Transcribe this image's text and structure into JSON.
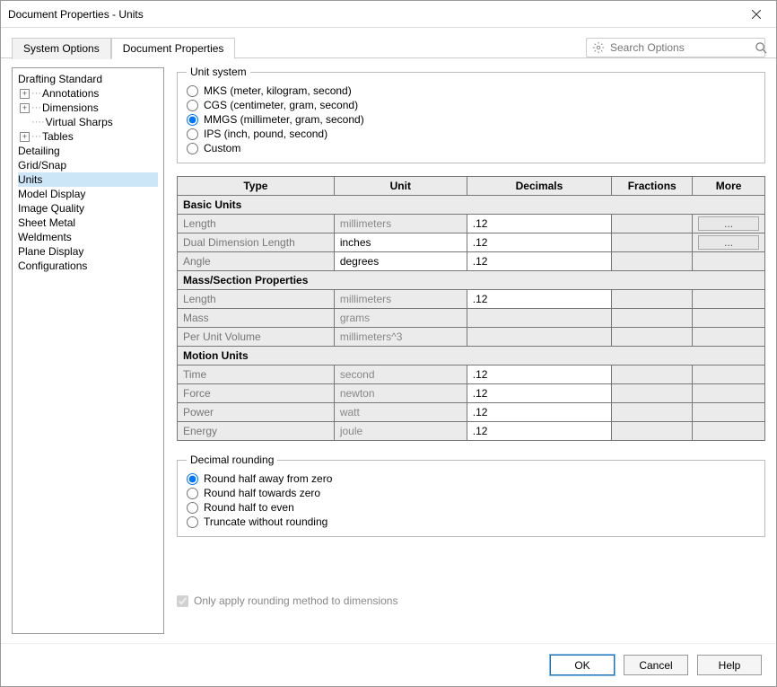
{
  "title": "Document Properties - Units",
  "tabs": {
    "system_options": "System Options",
    "document_properties": "Document Properties"
  },
  "search": {
    "placeholder": "Search Options"
  },
  "tree": {
    "drafting_standard": "Drafting Standard",
    "annotations": "Annotations",
    "dimensions": "Dimensions",
    "virtual_sharps": "Virtual Sharps",
    "tables": "Tables",
    "detailing": "Detailing",
    "grid_snap": "Grid/Snap",
    "units": "Units",
    "model_display": "Model Display",
    "image_quality": "Image Quality",
    "sheet_metal": "Sheet Metal",
    "weldments": "Weldments",
    "plane_display": "Plane Display",
    "configurations": "Configurations"
  },
  "unit_system": {
    "legend": "Unit system",
    "mks": "MKS (meter, kilogram, second)",
    "cgs": "CGS (centimeter, gram, second)",
    "mmgs": "MMGS (millimeter, gram, second)",
    "ips": "IPS (inch, pound, second)",
    "custom": "Custom"
  },
  "table": {
    "headers": {
      "type": "Type",
      "unit": "Unit",
      "decimals": "Decimals",
      "fractions": "Fractions",
      "more": "More"
    },
    "sections": {
      "basic": "Basic Units",
      "mass": "Mass/Section Properties",
      "motion": "Motion Units"
    },
    "rows": {
      "length1": {
        "type": "Length",
        "unit": "millimeters",
        "dec": ".12"
      },
      "dual": {
        "type": "Dual Dimension Length",
        "unit": "inches",
        "dec": ".12"
      },
      "angle": {
        "type": "Angle",
        "unit": "degrees",
        "dec": ".12"
      },
      "length2": {
        "type": "Length",
        "unit": "millimeters",
        "dec": ".12"
      },
      "mass": {
        "type": "Mass",
        "unit": "grams"
      },
      "pervol": {
        "type": "Per Unit Volume",
        "unit": "millimeters^3"
      },
      "time": {
        "type": "Time",
        "unit": "second",
        "dec": ".12"
      },
      "force": {
        "type": "Force",
        "unit": "newton",
        "dec": ".12"
      },
      "power": {
        "type": "Power",
        "unit": "watt",
        "dec": ".12"
      },
      "energy": {
        "type": "Energy",
        "unit": "joule",
        "dec": ".12"
      }
    },
    "more_btn": "..."
  },
  "rounding": {
    "legend": "Decimal rounding",
    "half_away": "Round half away from zero",
    "half_towards": "Round half towards zero",
    "half_even": "Round half to even",
    "truncate": "Truncate without rounding"
  },
  "only_apply": "Only apply rounding method to dimensions",
  "buttons": {
    "ok": "OK",
    "cancel": "Cancel",
    "help": "Help"
  }
}
